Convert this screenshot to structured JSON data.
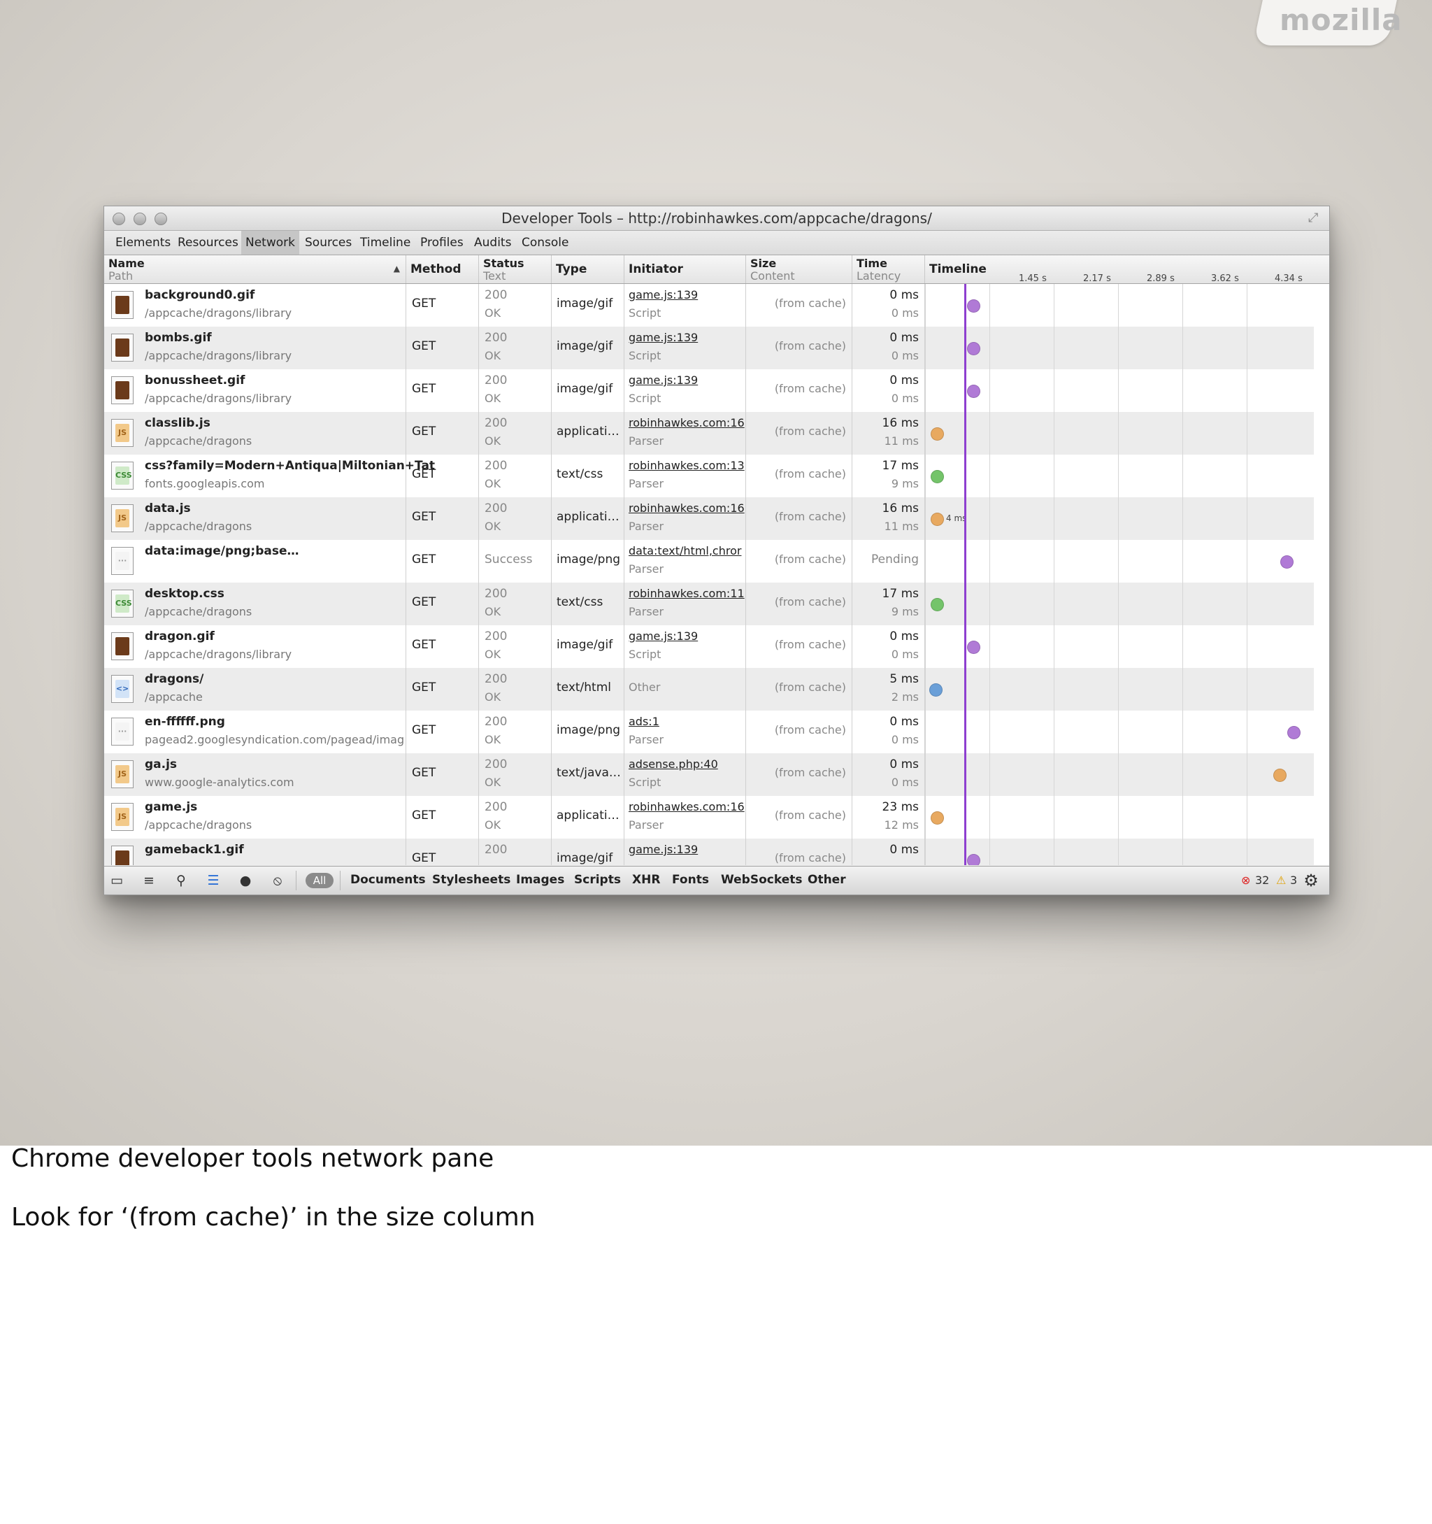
{
  "slide": {
    "logo": "mozilla"
  },
  "window": {
    "title": "Developer Tools – http://robinhawkes.com/appcache/dragons/",
    "tabs": [
      "Elements",
      "Resources",
      "Network",
      "Sources",
      "Timeline",
      "Profiles",
      "Audits",
      "Console"
    ],
    "active_tab": "Network"
  },
  "columns": {
    "name": "Name",
    "path": "Path",
    "method": "Method",
    "status": "Status",
    "status_text": "Text",
    "type": "Type",
    "initiator": "Initiator",
    "size": "Size",
    "content": "Content",
    "time": "Time",
    "latency": "Latency",
    "timeline": "Timeline",
    "ticks": [
      "1.45 s",
      "2.17 s",
      "2.89 s",
      "3.62 s",
      "4.34 s"
    ]
  },
  "rows": [
    {
      "name": "background0.gif",
      "path": "/appcache/dragons/library",
      "method": "GET",
      "status": "200",
      "status_text": "OK",
      "type": "image/gif",
      "initiator": "game.js:139",
      "initiator_type": "Script",
      "size": "(from cache)",
      "time": "0 ms",
      "latency": "0 ms",
      "icon": "gif-image-icon",
      "dot_color": "#b07ad6"
    },
    {
      "name": "bombs.gif",
      "path": "/appcache/dragons/library",
      "method": "GET",
      "status": "200",
      "status_text": "OK",
      "type": "image/gif",
      "initiator": "game.js:139",
      "initiator_type": "Script",
      "size": "(from cache)",
      "time": "0 ms",
      "latency": "0 ms",
      "icon": "gif-image-icon",
      "dot_color": "#b07ad6"
    },
    {
      "name": "bonussheet.gif",
      "path": "/appcache/dragons/library",
      "method": "GET",
      "status": "200",
      "status_text": "OK",
      "type": "image/gif",
      "initiator": "game.js:139",
      "initiator_type": "Script",
      "size": "(from cache)",
      "time": "0 ms",
      "latency": "0 ms",
      "icon": "gif-image-icon",
      "dot_color": "#b07ad6"
    },
    {
      "name": "classlib.js",
      "path": "/appcache/dragons",
      "method": "GET",
      "status": "200",
      "status_text": "OK",
      "type": "applicati…",
      "initiator": "robinhawkes.com:16",
      "initiator_type": "Parser",
      "size": "(from cache)",
      "time": "16 ms",
      "latency": "11 ms",
      "icon": "js-file-icon",
      "dot_color": "#e8a960"
    },
    {
      "name": "css?family=Modern+Antiqua|Miltonian+Tat",
      "path": "fonts.googleapis.com",
      "method": "GET",
      "status": "200",
      "status_text": "OK",
      "type": "text/css",
      "initiator": "robinhawkes.com:13",
      "initiator_type": "Parser",
      "size": "(from cache)",
      "time": "17 ms",
      "latency": "9 ms",
      "icon": "css-file-icon",
      "dot_color": "#74c46a"
    },
    {
      "name": "data.js",
      "path": "/appcache/dragons",
      "method": "GET",
      "status": "200",
      "status_text": "OK",
      "type": "applicati…",
      "initiator": "robinhawkes.com:16",
      "initiator_type": "Parser",
      "size": "(from cache)",
      "time": "16 ms",
      "latency": "11 ms",
      "icon": "js-file-icon",
      "dot_color": "#e8a960",
      "dot_label": "4 ms"
    },
    {
      "name": "data:image/png;base…",
      "path": "",
      "method": "GET",
      "status": "Success",
      "status_text": "",
      "type": "image/png",
      "initiator": "data:text/html,chror",
      "initiator_type": "Parser",
      "size": "(from cache)",
      "time": "Pending",
      "latency": "",
      "icon": "png-image-icon",
      "dot_color": "#b07ad6"
    },
    {
      "name": "desktop.css",
      "path": "/appcache/dragons",
      "method": "GET",
      "status": "200",
      "status_text": "OK",
      "type": "text/css",
      "initiator": "robinhawkes.com:11",
      "initiator_type": "Parser",
      "size": "(from cache)",
      "time": "17 ms",
      "latency": "9 ms",
      "icon": "css-file-icon",
      "dot_color": "#74c46a"
    },
    {
      "name": "dragon.gif",
      "path": "/appcache/dragons/library",
      "method": "GET",
      "status": "200",
      "status_text": "OK",
      "type": "image/gif",
      "initiator": "game.js:139",
      "initiator_type": "Script",
      "size": "(from cache)",
      "time": "0 ms",
      "latency": "0 ms",
      "icon": "gif-image-icon",
      "dot_color": "#b07ad6"
    },
    {
      "name": "dragons/",
      "path": "/appcache",
      "method": "GET",
      "status": "200",
      "status_text": "OK",
      "type": "text/html",
      "initiator": "",
      "initiator_type": "Other",
      "size": "(from cache)",
      "time": "5 ms",
      "latency": "2 ms",
      "icon": "html-file-icon",
      "dot_color": "#6a9fd8"
    },
    {
      "name": "en-ffffff.png",
      "path": "pagead2.googlesyndication.com/pagead/imag",
      "method": "GET",
      "status": "200",
      "status_text": "OK",
      "type": "image/png",
      "initiator": "ads:1",
      "initiator_type": "Parser",
      "size": "(from cache)",
      "time": "0 ms",
      "latency": "0 ms",
      "icon": "png-image-icon",
      "dot_color": "#b07ad6"
    },
    {
      "name": "ga.js",
      "path": "www.google-analytics.com",
      "method": "GET",
      "status": "200",
      "status_text": "OK",
      "type": "text/java…",
      "initiator": "adsense.php:40",
      "initiator_type": "Script",
      "size": "(from cache)",
      "time": "0 ms",
      "latency": "0 ms",
      "icon": "js-file-icon",
      "dot_color": "#e8a960"
    },
    {
      "name": "game.js",
      "path": "/appcache/dragons",
      "method": "GET",
      "status": "200",
      "status_text": "OK",
      "type": "applicati…",
      "initiator": "robinhawkes.com:16",
      "initiator_type": "Parser",
      "size": "(from cache)",
      "time": "23 ms",
      "latency": "12 ms",
      "icon": "js-file-icon",
      "dot_color": "#e8a960"
    },
    {
      "name": "gameback1.gif",
      "path": "",
      "method": "GET",
      "status": "200",
      "status_text": "",
      "type": "image/gif",
      "initiator": "game.js:139",
      "initiator_type": "",
      "size": "(from cache)",
      "time": "0 ms",
      "latency": "",
      "icon": "gif-image-icon",
      "dot_color": "#b07ad6"
    }
  ],
  "statusbar": {
    "all_label": "All",
    "filters": [
      "Documents",
      "Stylesheets",
      "Images",
      "Scripts",
      "XHR",
      "Fonts",
      "WebSockets",
      "Other"
    ],
    "errors": "32",
    "warnings": "3"
  },
  "captions": {
    "line1": "Chrome developer tools network pane",
    "line2": "Look for ‘(from cache)’ in the size column"
  }
}
